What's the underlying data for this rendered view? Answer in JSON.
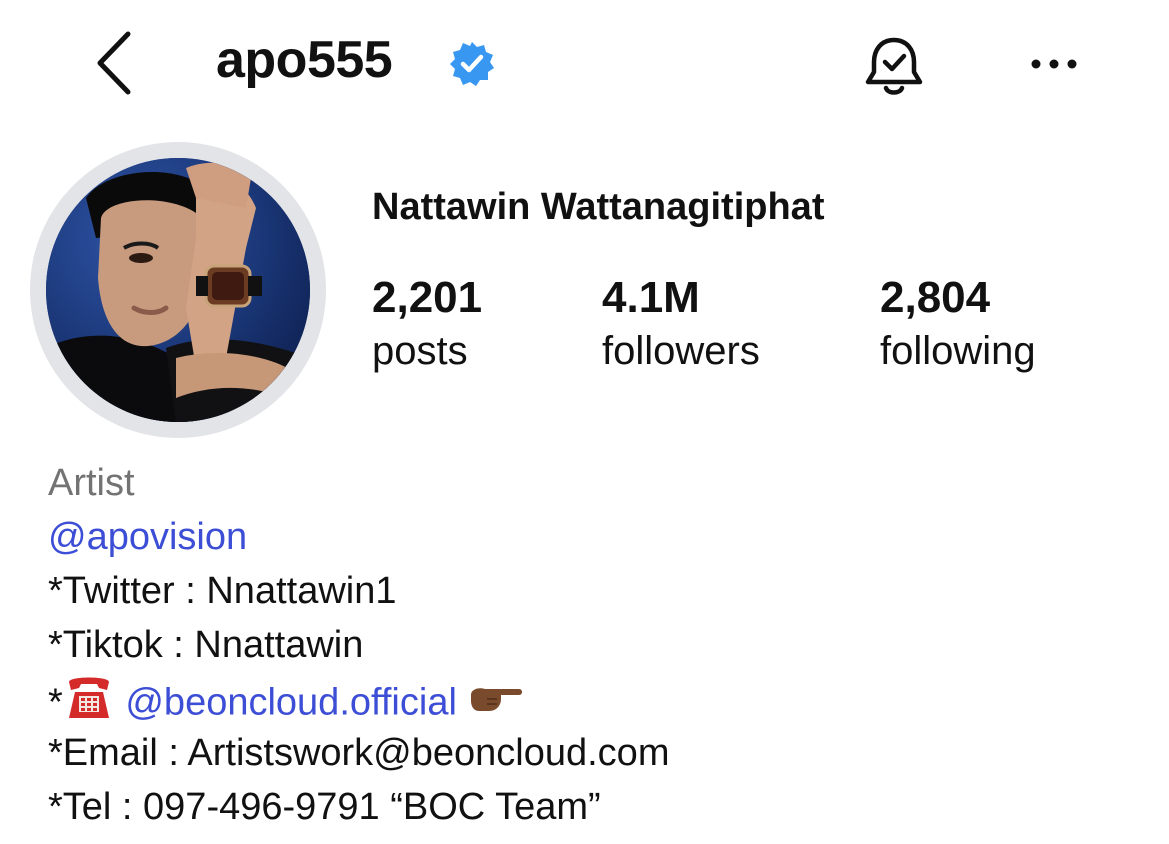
{
  "header": {
    "username": "apo555",
    "verified": true
  },
  "profile": {
    "full_name": "Nattawin Wattanagitiphat",
    "stats": [
      {
        "value": "2,201",
        "label": "posts"
      },
      {
        "value": "4.1M",
        "label": "followers"
      },
      {
        "value": "2,804",
        "label": "following"
      }
    ]
  },
  "bio": {
    "category": "Artist",
    "mention": "@apovision",
    "twitter": "*Twitter : Nnattawin1",
    "tiktok": "*Tiktok : Nnattawin",
    "contact_prefix": "*",
    "contact_link": "@beoncloud.official",
    "email": "*Email : Artistswork@beoncloud.com",
    "tel": "*Tel : 097-496-9791 “BOC Team”"
  },
  "icons": {
    "back": "chevron-left-icon",
    "verified": "verified-badge-icon",
    "notifications": "bell-check-icon",
    "more": "ellipsis-icon",
    "telephone": "telephone-emoji",
    "pointing": "pointing-right-emoji"
  },
  "colors": {
    "verified_blue": "#3897f0",
    "link_blue": "#3d4ed6",
    "category_gray": "#737373",
    "text": "#111111"
  }
}
